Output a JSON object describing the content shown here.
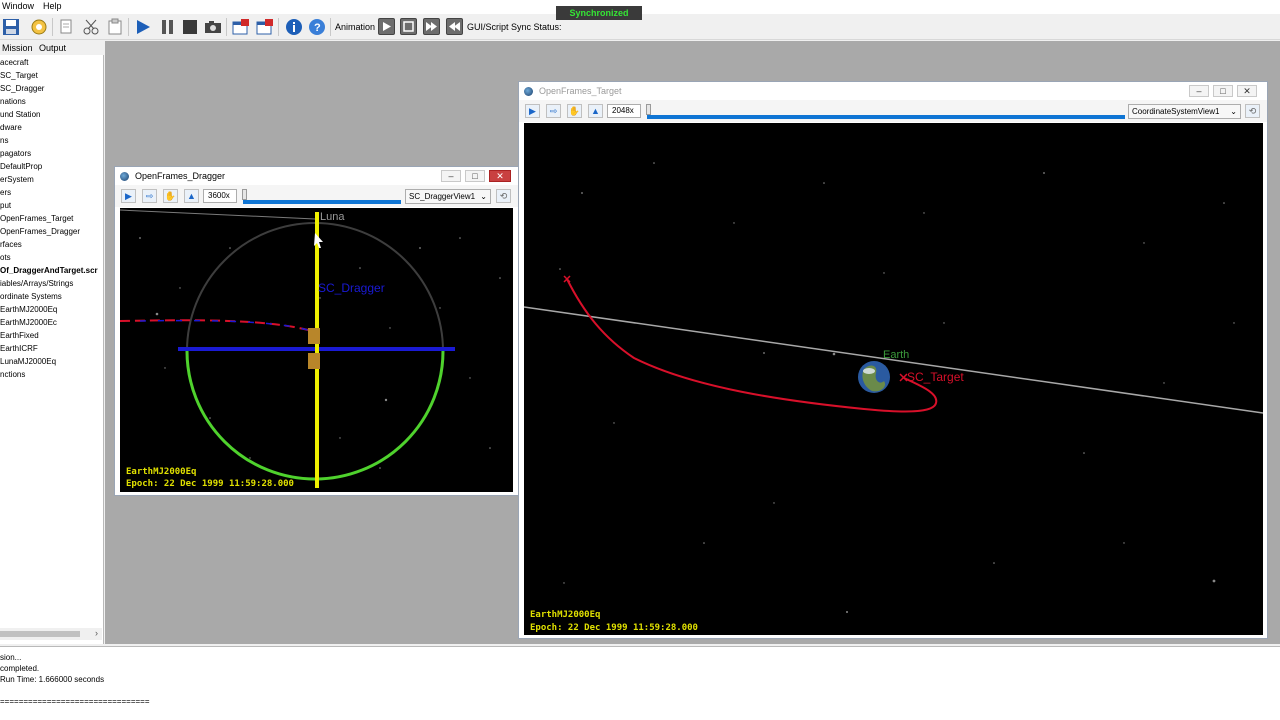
{
  "menubar": {
    "window": "Window",
    "help": "Help"
  },
  "toolbar": {
    "animation_label": "Animation",
    "sync_label": "GUI/Script Sync Status:",
    "sync_status": "Synchronized"
  },
  "left_panel": {
    "tabs": [
      "Mission",
      "Output"
    ],
    "tree": [
      "acecraft",
      "SC_Target",
      "SC_Dragger",
      "nations",
      "und Station",
      "dware",
      "ns",
      "pagators",
      "DefaultProp",
      "erSystem",
      "ers",
      "put",
      "OpenFrames_Target",
      "OpenFrames_Dragger",
      "rfaces",
      "ots",
      "Of_DraggerAndTarget.scr",
      "iables/Arrays/Strings",
      "ordinate Systems",
      "EarthMJ2000Eq",
      "EarthMJ2000Ec",
      "EarthFixed",
      "EarthICRF",
      "LunaMJ2000Eq",
      "nctions"
    ]
  },
  "dragger_window": {
    "title": "OpenFrames_Dragger",
    "speed": "3600x",
    "view_select": "SC_DraggerView1",
    "body_label": "Luna",
    "sc_label": "SC_Dragger",
    "coord": "EarthMJ2000Eq",
    "epoch": "Epoch: 22 Dec 1999 11:59:28.000"
  },
  "target_window": {
    "title": "OpenFrames_Target",
    "speed": "2048x",
    "view_select": "CoordinateSystemView1",
    "body_label": "Earth",
    "sc_label": "SC_Target",
    "coord": "EarthMJ2000Eq",
    "epoch": "Epoch: 22 Dec 1999 11:59:28.000"
  },
  "output": {
    "lines": [
      "sion...",
      "completed.",
      "Run Time: 1.666000 seconds",
      "================================"
    ]
  },
  "colors": {
    "sync_green": "#35e535",
    "orbit_red": "#d8102a",
    "axis_blue": "#1a1ad4",
    "axis_yellow": "#f0f000",
    "overlay_yellow": "#e0e000"
  }
}
